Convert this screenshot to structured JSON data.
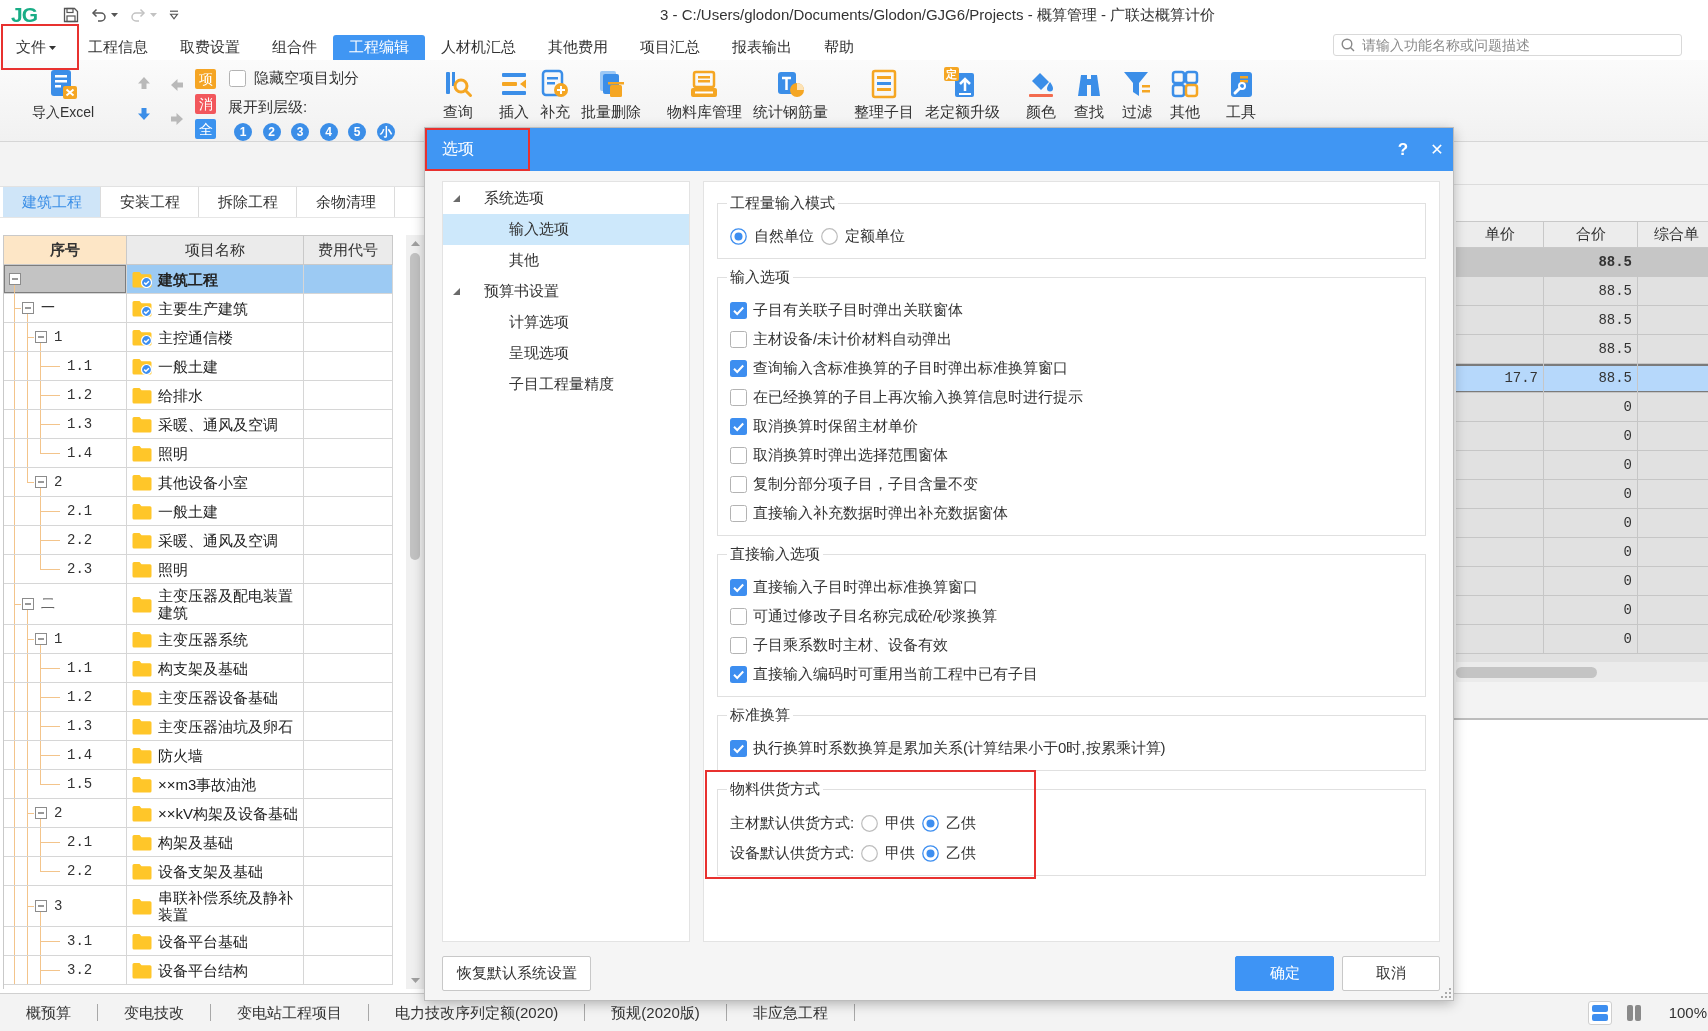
{
  "title_bar": {
    "logo": "JG",
    "quick_access": [
      {
        "kind": "save",
        "disabled": false,
        "dropdown": false
      },
      {
        "kind": "undo",
        "disabled": false,
        "dropdown": true
      },
      {
        "kind": "redo",
        "disabled": true,
        "dropdown": true
      },
      {
        "kind": "customize",
        "disabled": false,
        "dropdown": false
      }
    ],
    "title": "3 - C:/Users/glodon/Documents/Glodon/GJG6/Projects - 概算管理 - 广联达概算计价"
  },
  "menu_bar": {
    "items": [
      {
        "label": "文件",
        "dropdown": true,
        "selected": false,
        "highlighted": true
      },
      {
        "label": "工程信息",
        "dropdown": false,
        "selected": false,
        "highlighted": false
      },
      {
        "label": "取费设置",
        "dropdown": false,
        "selected": false,
        "highlighted": false
      },
      {
        "label": "组合件",
        "dropdown": false,
        "selected": false,
        "highlighted": false
      },
      {
        "label": "工程编辑",
        "dropdown": false,
        "selected": true,
        "highlighted": false
      },
      {
        "label": "人材机汇总",
        "dropdown": false,
        "selected": false,
        "highlighted": false
      },
      {
        "label": "其他费用",
        "dropdown": false,
        "selected": false,
        "highlighted": false
      },
      {
        "label": "项目汇总",
        "dropdown": false,
        "selected": false,
        "highlighted": false
      },
      {
        "label": "报表输出",
        "dropdown": false,
        "selected": false,
        "highlighted": false
      },
      {
        "label": "帮助",
        "dropdown": false,
        "selected": false,
        "highlighted": false
      }
    ],
    "search": {
      "placeholder": "请输入功能名称或问题描述"
    }
  },
  "ribbon": {
    "import": {
      "label": "导入Excel"
    },
    "move_buttons": [
      {
        "kind": "up",
        "disabled": true
      },
      {
        "kind": "down",
        "disabled": false
      },
      {
        "kind": "left",
        "disabled": true
      },
      {
        "kind": "right",
        "disabled": true
      }
    ],
    "mark_buttons": [
      {
        "label": "项",
        "color": "#f5a524"
      },
      {
        "label": "消",
        "color": "#f2575c"
      },
      {
        "label": "全",
        "color": "#3b93ef"
      }
    ],
    "hide_empty": {
      "label": "隐藏空项目划分",
      "checked": false
    },
    "expand_label": "展开到层级:",
    "levels": [
      "1",
      "2",
      "3",
      "4",
      "5",
      "小"
    ],
    "tool_groups": [
      [
        {
          "kind": "query",
          "label": "查询"
        }
      ],
      [
        {
          "kind": "insert",
          "label": "插入"
        },
        {
          "kind": "supplement",
          "label": "补充"
        },
        {
          "kind": "batch-delete",
          "label": "批量删除"
        }
      ],
      [
        {
          "kind": "material-library",
          "label": "物料库管理"
        },
        {
          "kind": "rebar",
          "label": "统计钢筋量"
        }
      ],
      [
        {
          "kind": "tidy",
          "label": "整理子目"
        },
        {
          "kind": "upgrade",
          "label": "老定额升级",
          "badge": "定"
        }
      ],
      [
        {
          "kind": "color",
          "label": "颜色"
        },
        {
          "kind": "find",
          "label": "查找"
        },
        {
          "kind": "filter",
          "label": "过滤"
        },
        {
          "kind": "more",
          "label": "其他"
        }
      ],
      [
        {
          "kind": "tools",
          "label": "工具"
        }
      ]
    ]
  },
  "project_tabs": [
    {
      "label": "建筑工程",
      "selected": true
    },
    {
      "label": "安装工程",
      "selected": false
    },
    {
      "label": "拆除工程",
      "selected": false
    },
    {
      "label": "余物清理",
      "selected": false
    }
  ],
  "project_tree": {
    "columns": [
      "序号",
      "项目名称",
      "费用代号"
    ],
    "continues_below": true,
    "rows": [
      {
        "name": "建筑工程",
        "checked": true,
        "selected": true,
        "expanded": true,
        "children": [
          {
            "code": "一",
            "name": "主要生产建筑",
            "checked": true,
            "selected": false,
            "expanded": true,
            "children": [
              {
                "code": "1",
                "name": "主控通信楼",
                "checked": true,
                "selected": false,
                "expanded": true,
                "children": [
                  {
                    "code": "1.1",
                    "name": "一般土建",
                    "checked": true,
                    "selected": false
                  },
                  {
                    "code": "1.2",
                    "name": "给排水",
                    "checked": false,
                    "selected": false
                  },
                  {
                    "code": "1.3",
                    "name": "采暖、通风及空调",
                    "checked": false,
                    "selected": false
                  },
                  {
                    "code": "1.4",
                    "name": "照明",
                    "checked": false,
                    "selected": false
                  }
                ]
              },
              {
                "code": "2",
                "name": "其他设备小室",
                "checked": false,
                "selected": false,
                "expanded": true,
                "children": [
                  {
                    "code": "2.1",
                    "name": "一般土建",
                    "checked": false,
                    "selected": false
                  },
                  {
                    "code": "2.2",
                    "name": "采暖、通风及空调",
                    "checked": false,
                    "selected": false
                  },
                  {
                    "code": "2.3",
                    "name": "照明",
                    "checked": false,
                    "selected": false
                  }
                ]
              }
            ]
          },
          {
            "code": "二",
            "name": "主变压器及配电装置建筑",
            "checked": false,
            "selected": false,
            "expanded": true,
            "children": [
              {
                "code": "1",
                "name": "主变压器系统",
                "checked": false,
                "selected": false,
                "expanded": true,
                "children": [
                  {
                    "code": "1.1",
                    "name": "构支架及基础",
                    "checked": false,
                    "selected": false
                  },
                  {
                    "code": "1.2",
                    "name": "主变压器设备基础",
                    "checked": false,
                    "selected": false
                  },
                  {
                    "code": "1.3",
                    "name": "主变压器油坑及卵石",
                    "checked": false,
                    "selected": false
                  },
                  {
                    "code": "1.4",
                    "name": "防火墙",
                    "checked": false,
                    "selected": false
                  },
                  {
                    "code": "1.5",
                    "name": "××m3事故油池",
                    "checked": false,
                    "selected": false
                  }
                ]
              },
              {
                "code": "2",
                "name": "××kV构架及设备基础",
                "checked": false,
                "selected": false,
                "expanded": true,
                "children": [
                  {
                    "code": "2.1",
                    "name": "构架及基础",
                    "checked": false,
                    "selected": false
                  },
                  {
                    "code": "2.2",
                    "name": "设备支架及基础",
                    "checked": false,
                    "selected": false
                  }
                ]
              },
              {
                "code": "3",
                "name": "串联补偿系统及静补装置",
                "checked": false,
                "selected": false,
                "expanded": true,
                "children": [
                  {
                    "code": "3.1",
                    "name": "设备平台基础",
                    "checked": false,
                    "selected": false
                  },
                  {
                    "code": "3.2",
                    "name": "设备平台结构",
                    "checked": false,
                    "selected": false
                  }
                ]
              }
            ]
          }
        ]
      }
    ]
  },
  "budget_grid": {
    "columns": [
      "单价",
      "合价",
      "综合单"
    ],
    "rows": [
      {
        "kind": "summary",
        "selected": false,
        "total": "88.5"
      },
      {
        "kind": "item",
        "selected": false,
        "total": "88.5"
      },
      {
        "kind": "item",
        "selected": false,
        "total": "88.5"
      },
      {
        "kind": "item",
        "selected": false,
        "total": "88.5"
      },
      {
        "kind": "item",
        "selected": true,
        "unit_price": "17.7",
        "total": "88.5"
      },
      {
        "kind": "item",
        "selected": false,
        "total": "0"
      },
      {
        "kind": "item",
        "selected": false,
        "total": "0"
      },
      {
        "kind": "item",
        "selected": false,
        "total": "0"
      },
      {
        "kind": "item",
        "selected": false,
        "total": "0"
      },
      {
        "kind": "item",
        "selected": false,
        "total": "0"
      },
      {
        "kind": "item",
        "selected": false,
        "total": "0"
      },
      {
        "kind": "item",
        "selected": false,
        "total": "0"
      },
      {
        "kind": "item",
        "selected": false,
        "total": "0"
      },
      {
        "kind": "item",
        "selected": false,
        "total": "0"
      }
    ]
  },
  "options_dialog": {
    "title": "选项",
    "title_highlighted": true,
    "help": "?",
    "close": "✕",
    "nav": [
      {
        "label": "系统选项",
        "expanded": true,
        "selected": false,
        "children": [
          {
            "label": "输入选项",
            "selected": true
          },
          {
            "label": "其他",
            "selected": false
          }
        ]
      },
      {
        "label": "预算书设置",
        "expanded": true,
        "selected": false,
        "children": [
          {
            "label": "计算选项",
            "selected": false
          },
          {
            "label": "呈现选项",
            "selected": false
          },
          {
            "label": "子目工程量精度",
            "selected": false
          }
        ]
      }
    ],
    "groups": [
      {
        "kind": "radios",
        "title": "工程量输入模式",
        "highlighted": false,
        "options": [
          {
            "label": "自然单位",
            "selected": true
          },
          {
            "label": "定额单位",
            "selected": false
          }
        ]
      },
      {
        "kind": "checks",
        "title": "输入选项",
        "highlighted": false,
        "items": [
          {
            "label": "子目有关联子目时弹出关联窗体",
            "checked": true
          },
          {
            "label": "主材设备/未计价材料自动弹出",
            "checked": false
          },
          {
            "label": "查询输入含标准换算的子目时弹出标准换算窗口",
            "checked": true
          },
          {
            "label": "在已经换算的子目上再次输入换算信息时进行提示",
            "checked": false
          },
          {
            "label": "取消换算时保留主材单价",
            "checked": true
          },
          {
            "label": "取消换算时弹出选择范围窗体",
            "checked": false
          },
          {
            "label": "复制分部分项子目，子目含量不变",
            "checked": false
          },
          {
            "label": "直接输入补充数据时弹出补充数据窗体",
            "checked": false
          }
        ]
      },
      {
        "kind": "checks",
        "title": "直接输入选项",
        "highlighted": false,
        "items": [
          {
            "label": "直接输入子目时弹出标准换算窗口",
            "checked": true
          },
          {
            "label": "可通过修改子目名称完成砼/砂浆换算",
            "checked": false
          },
          {
            "label": "子目乘系数时主材、设备有效",
            "checked": false
          },
          {
            "label": "直接输入编码时可重用当前工程中已有子目",
            "checked": true
          }
        ]
      },
      {
        "kind": "checks",
        "title": "标准换算",
        "highlighted": false,
        "items": [
          {
            "label": "执行换算时系数换算是累加关系(计算结果小于0时,按累乘计算)",
            "checked": true
          }
        ]
      },
      {
        "kind": "supply",
        "title": "物料供货方式",
        "highlighted": true,
        "rows": [
          {
            "label": "主材默认供货方式:",
            "options": [
              {
                "label": "甲供",
                "selected": false
              },
              {
                "label": "乙供",
                "selected": true
              }
            ]
          },
          {
            "label": "设备默认供货方式:",
            "options": [
              {
                "label": "甲供",
                "selected": false
              },
              {
                "label": "乙供",
                "selected": true
              }
            ]
          }
        ]
      }
    ],
    "buttons": [
      {
        "kind": "reset",
        "label": "恢复默认系统设置"
      },
      {
        "kind": "confirm",
        "label": "确定"
      },
      {
        "kind": "cancel",
        "label": "取消"
      }
    ]
  },
  "status_bar": {
    "tabs": [
      "概预算",
      "变电技改",
      "变电站工程项目",
      "电力技改序列定额(2020)",
      "预规(2020版)",
      "非应急工程"
    ],
    "view_buttons": [
      {
        "kind": "stacked",
        "selected": true
      },
      {
        "kind": "split",
        "selected": false
      }
    ],
    "zoom": "100%"
  }
}
